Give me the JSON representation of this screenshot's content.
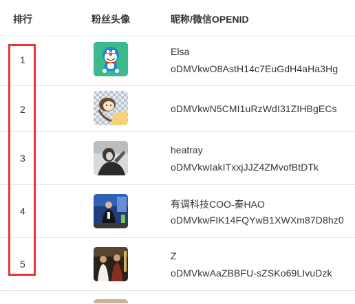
{
  "header": {
    "rank_label": "排行",
    "avatar_label": "粉丝头像",
    "name_label": "昵称/微信OPENID"
  },
  "rows": [
    {
      "rank": "1",
      "nickname": "Elsa",
      "openid": "oDMVkwO8AstH14c7EuGdH4aHa3Hg",
      "avatar": "doraemon-avatar"
    },
    {
      "rank": "2",
      "nickname": "",
      "openid": "oDMVkwN5CMI1uRzWdI31ZIHBgECs",
      "avatar": "cartoon-girl-avatar"
    },
    {
      "rank": "3",
      "nickname": "heatray",
      "openid": "oDMVkwIakITxxjJJZ4ZMvofBtDTk",
      "avatar": "bw-photo-avatar"
    },
    {
      "rank": "4",
      "nickname": "有调科技COO-秦HAO",
      "openid": "oDMVkwFIK14FQYwB1XWXm87D8hz0",
      "avatar": "speaker-stage-avatar"
    },
    {
      "rank": "5",
      "nickname": "Z",
      "openid": "oDMVkwAaZBBFU-sZSKo69LIvuDzk",
      "avatar": "group-photo-avatar"
    }
  ],
  "annotation": {
    "color": "#e8343c"
  }
}
